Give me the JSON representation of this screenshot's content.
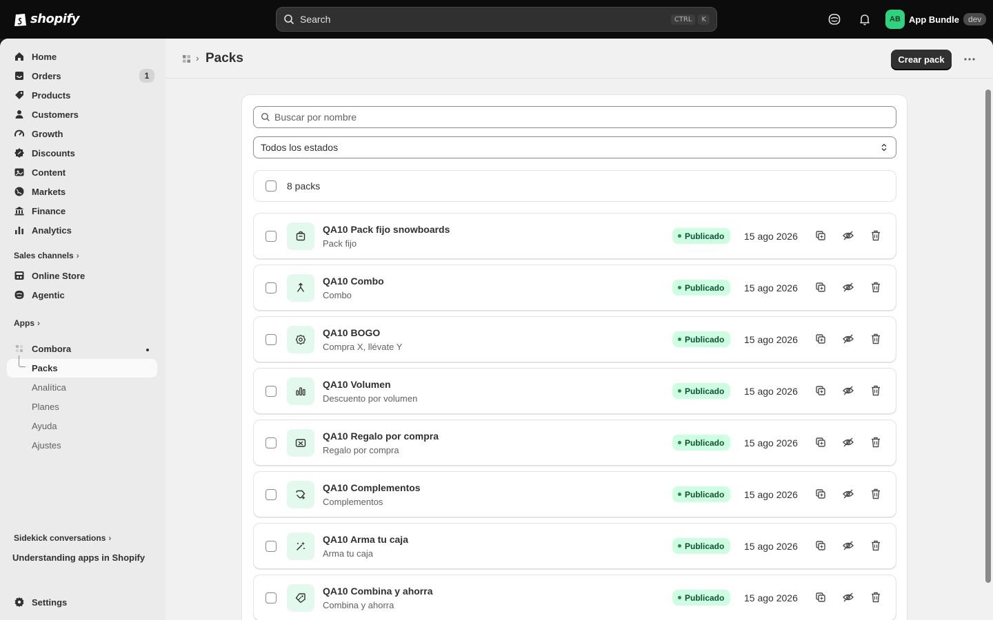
{
  "topbar": {
    "logo_text": "shopify",
    "search_label": "Search",
    "kbd_ctrl": "CTRL",
    "kbd_k": "K",
    "account_initials": "AB",
    "account_name": "App Bundle",
    "account_badge": "dev"
  },
  "sidebar": {
    "items": [
      {
        "label": "Home",
        "icon": "home-icon"
      },
      {
        "label": "Orders",
        "icon": "orders-icon",
        "badge": "1"
      },
      {
        "label": "Products",
        "icon": "tag-icon"
      },
      {
        "label": "Customers",
        "icon": "person-icon"
      },
      {
        "label": "Growth",
        "icon": "growth-icon"
      },
      {
        "label": "Discounts",
        "icon": "discount-icon"
      },
      {
        "label": "Content",
        "icon": "content-icon"
      },
      {
        "label": "Markets",
        "icon": "globe-icon"
      },
      {
        "label": "Finance",
        "icon": "bank-icon"
      },
      {
        "label": "Analytics",
        "icon": "chart-icon"
      }
    ],
    "sales_channels_label": "Sales channels",
    "channels": [
      {
        "label": "Online Store",
        "icon": "store-icon"
      },
      {
        "label": "Agentic",
        "icon": "agent-icon"
      }
    ],
    "apps_label": "Apps",
    "app_name": "Combora",
    "app_subitems": [
      "Packs",
      "Analítica",
      "Planes",
      "Ayuda",
      "Ajustes"
    ],
    "sidekick_label": "Sidekick conversations",
    "sidekick_item": "Understanding apps in Shopify",
    "settings_label": "Settings"
  },
  "header": {
    "title": "Packs",
    "primary_button": "Crear pack"
  },
  "filters": {
    "search_placeholder": "Buscar por nombre",
    "status_value": "Todos los estados"
  },
  "list": {
    "count_label": "8 packs",
    "rows": [
      {
        "title": "QA10 Pack fijo snowboards",
        "subtitle": "Pack fijo",
        "status": "Publicado",
        "date": "15 ago 2026",
        "icon": "package-icon"
      },
      {
        "title": "QA10 Combo",
        "subtitle": "Combo",
        "status": "Publicado",
        "date": "15 ago 2026",
        "icon": "merge-icon"
      },
      {
        "title": "QA10 BOGO",
        "subtitle": "Compra X, llévate Y",
        "status": "Publicado",
        "date": "15 ago 2026",
        "icon": "badge-gear-icon"
      },
      {
        "title": "QA10 Volumen",
        "subtitle": "Descuento por volumen",
        "status": "Publicado",
        "date": "15 ago 2026",
        "icon": "bars-icon"
      },
      {
        "title": "QA10 Regalo por compra",
        "subtitle": "Regalo por compra",
        "status": "Publicado",
        "date": "15 ago 2026",
        "icon": "gift-card-icon"
      },
      {
        "title": "QA10 Complementos",
        "subtitle": "Complementos",
        "status": "Publicado",
        "date": "15 ago 2026",
        "icon": "add-tag-icon"
      },
      {
        "title": "QA10 Arma tu caja",
        "subtitle": "Arma tu caja",
        "status": "Publicado",
        "date": "15 ago 2026",
        "icon": "magic-wand-icon"
      },
      {
        "title": "QA10 Combina y ahorra",
        "subtitle": "Combina y ahorra",
        "status": "Publicado",
        "date": "15 ago 2026",
        "icon": "tags-icon"
      }
    ]
  },
  "colors": {
    "topbar_bg": "#0c0c0c",
    "accent_green": "#cdfee1",
    "status_text": "#0c5132",
    "primary_button": "#303030"
  }
}
